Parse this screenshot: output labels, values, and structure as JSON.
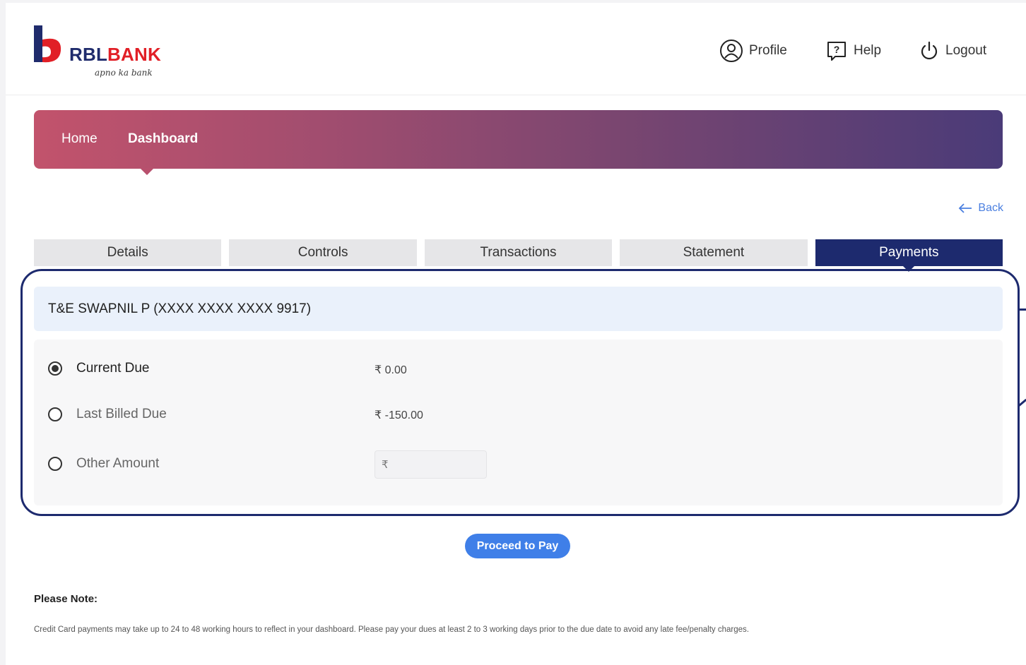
{
  "header": {
    "logo": {
      "name": "RBL",
      "name_accent": "BANK",
      "tagline": "apno ka bank"
    },
    "profile_label": "Profile",
    "help_label": "Help",
    "logout_label": "Logout"
  },
  "breadcrumb": {
    "home": "Home",
    "current": "Dashboard"
  },
  "back_label": "Back",
  "tabs": [
    {
      "label": "Details",
      "active": false
    },
    {
      "label": "Controls",
      "active": false
    },
    {
      "label": "Transactions",
      "active": false
    },
    {
      "label": "Statement",
      "active": false
    },
    {
      "label": "Payments",
      "active": true
    }
  ],
  "card": {
    "title": "T&E SWAPNIL P (XXXX XXXX XXXX 9917)",
    "options": [
      {
        "label": "Current Due",
        "value": "₹ 0.00",
        "selected": true
      },
      {
        "label": "Last Billed Due",
        "value": "₹ -150.00",
        "selected": false
      },
      {
        "label": "Other Amount",
        "value": "",
        "selected": false
      }
    ],
    "other_amount_placeholder": "₹"
  },
  "proceed_label": "Proceed to Pay",
  "note": {
    "title": "Please Note:",
    "text": "Credit Card payments may take up to 24 to 48 working hours to reflect in your dashboard. Please pay your dues at least 2 to 3 working days prior to the due date to avoid any late fee/penalty charges."
  },
  "colors": {
    "brand_navy": "#1d2a6e",
    "brand_red": "#e11f26",
    "accent_blue": "#3f7fe8",
    "banner_start": "#c2536c",
    "banner_end": "#4a3b78"
  }
}
